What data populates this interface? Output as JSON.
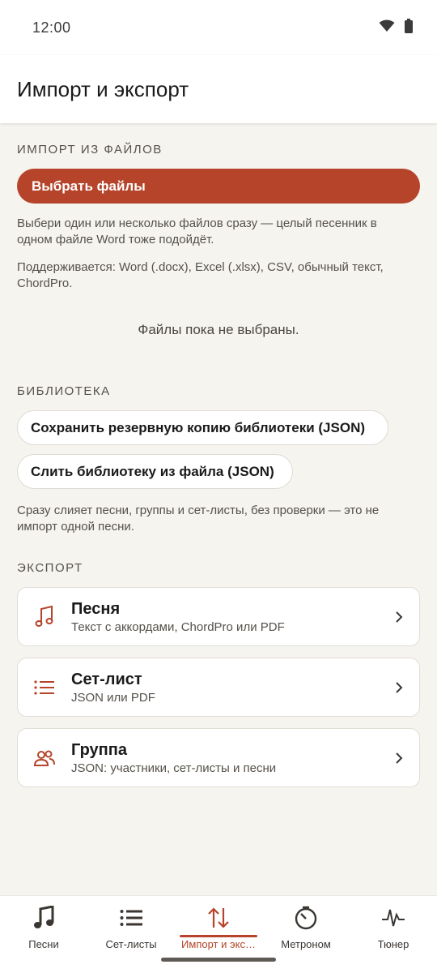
{
  "status_bar": {
    "time": "12:00"
  },
  "app_bar": {
    "title": "Импорт и экспорт"
  },
  "import_section": {
    "label": "ИМПОРТ ИЗ ФАЙЛОВ",
    "choose_button": "Выбрать файлы",
    "helper_1": "Выбери один или несколько файлов сразу — целый песенник в одном файле Word тоже подойдёт.",
    "helper_2": "Поддерживается: Word (.docx), Excel (.xlsx), CSV, обычный текст, ChordPro.",
    "empty_state": "Файлы пока не выбраны."
  },
  "library_section": {
    "label": "БИБЛИОТЕКА",
    "backup_button": "Сохранить резервную копию библиотеки (JSON)",
    "merge_button": "Слить библиотеку из файла (JSON)",
    "helper": "Сразу слияет песни, группы и сет-листы, без проверки — это не импорт одной песни."
  },
  "export_section": {
    "label": "ЭКСПОРТ",
    "items": [
      {
        "title": "Песня",
        "subtitle": "Текст с аккордами, ChordPro или PDF",
        "icon": "music-note-icon"
      },
      {
        "title": "Сет-лист",
        "subtitle": "JSON или PDF",
        "icon": "list-icon"
      },
      {
        "title": "Группа",
        "subtitle": "JSON: участники, сет-листы и песни",
        "icon": "people-icon"
      }
    ]
  },
  "bottom_nav": {
    "items": [
      {
        "label": "Песни",
        "icon": "music-note-icon"
      },
      {
        "label": "Сет-листы",
        "icon": "list-icon"
      },
      {
        "label": "Импорт и экс…",
        "icon": "swap-vertical-icon",
        "active": true
      },
      {
        "label": "Метроном",
        "icon": "metronome-icon"
      },
      {
        "label": "Тюнер",
        "icon": "tuner-icon"
      }
    ]
  },
  "colors": {
    "accent": "#b5442a",
    "background": "#f6f4ef"
  }
}
